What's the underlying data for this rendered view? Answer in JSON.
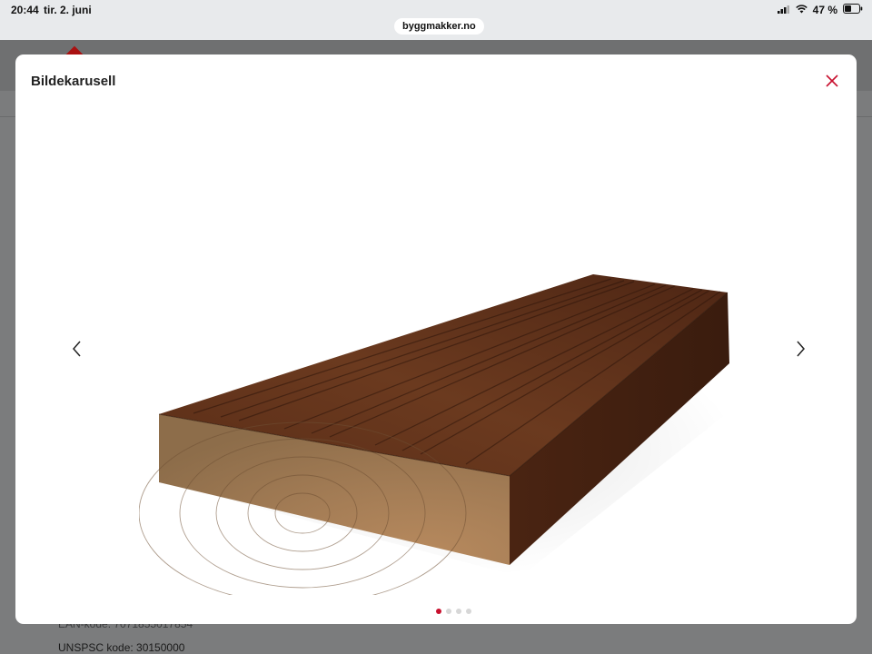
{
  "status_bar": {
    "time": "20:44",
    "date": "tir. 2. juni",
    "battery": "47 %",
    "url": "byggmakker.no"
  },
  "background_page": {
    "ean_label": "EAN-kode: 7071855017854",
    "unspsc_label": "UNSPSC kode: 30150000"
  },
  "modal": {
    "title": "Bildekarusell",
    "accent_color": "#c8102e",
    "close_icon": "close-icon",
    "prev_icon": "chevron-left-icon",
    "next_icon": "chevron-right-icon",
    "slide_count": 4,
    "active_slide": 1
  }
}
